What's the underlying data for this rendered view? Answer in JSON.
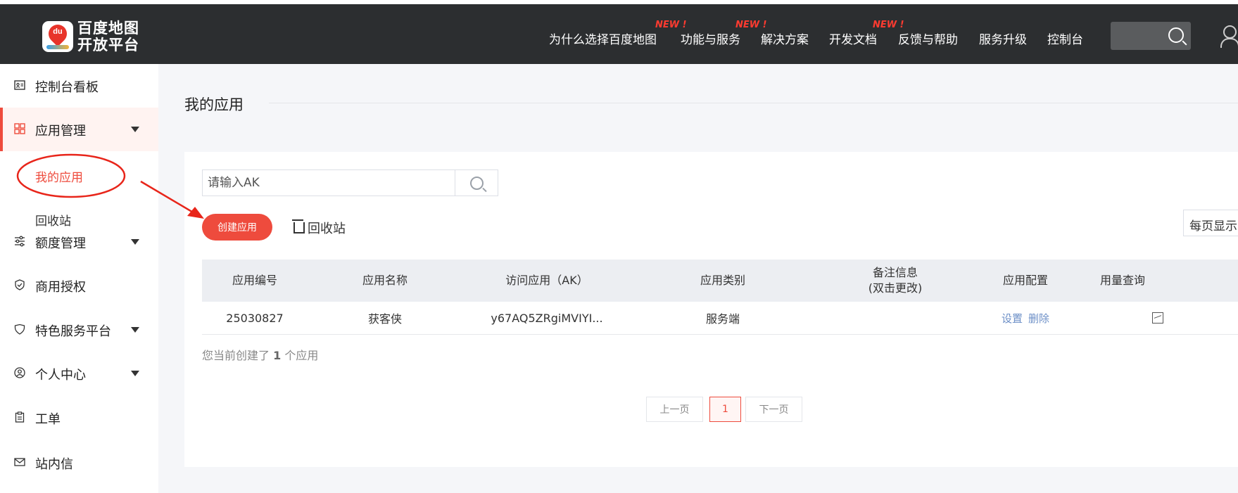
{
  "header": {
    "logo_line1": "百度地图",
    "logo_line2": "开放平台",
    "logo_badge": "du",
    "nav": [
      {
        "label": "为什么选择百度地图",
        "new": ""
      },
      {
        "label": "功能与服务",
        "new": "NEW !"
      },
      {
        "label": "解决方案",
        "new": "NEW !"
      },
      {
        "label": "开发文档",
        "new": "NEW !"
      },
      {
        "label": "反馈与帮助",
        "new": ""
      },
      {
        "label": "服务升级",
        "new": ""
      },
      {
        "label": "控制台",
        "new": ""
      }
    ],
    "search_value": ""
  },
  "sidebar": {
    "items": [
      {
        "label": "控制台看板",
        "icon": "id-card-icon"
      },
      {
        "label": "应用管理",
        "icon": "grid-icon"
      },
      {
        "label": "额度管理",
        "icon": "sliders-icon"
      },
      {
        "label": "商用授权",
        "icon": "shield-check-icon"
      },
      {
        "label": "特色服务平台",
        "icon": "heart-shield-icon"
      },
      {
        "label": "个人中心",
        "icon": "user-circle-icon"
      },
      {
        "label": "工单",
        "icon": "clipboard-icon"
      },
      {
        "label": "站内信",
        "icon": "mail-icon"
      }
    ],
    "sub_items": [
      "我的应用",
      "回收站"
    ]
  },
  "main": {
    "title": "我的应用",
    "ak_placeholder": "请输入AK",
    "create_label": "创建应用",
    "recycle_label": "回收站",
    "perpage_label": "每页显示",
    "columns": [
      "应用编号",
      "应用名称",
      "访问应用（AK）",
      "应用类别",
      "备注信息",
      "(双击更改)",
      "应用配置",
      "用量查询"
    ],
    "rows": [
      {
        "id": "25030827",
        "name": "获客侠",
        "ak": "y67AQ5ZRgiMVIYI...",
        "type": "服务端",
        "note": "",
        "config_set": "设置",
        "config_delete": "删除"
      }
    ],
    "summary_prefix": "您当前创建了 ",
    "summary_count": "1",
    "summary_suffix": " 个应用",
    "pager": {
      "prev": "上一页",
      "current": "1",
      "next": "下一页"
    }
  },
  "colors": {
    "accent": "#ee4b3d",
    "topbar": "#2c2e30",
    "new_badge": "#ff3b30",
    "link": "#6c8fc7"
  }
}
